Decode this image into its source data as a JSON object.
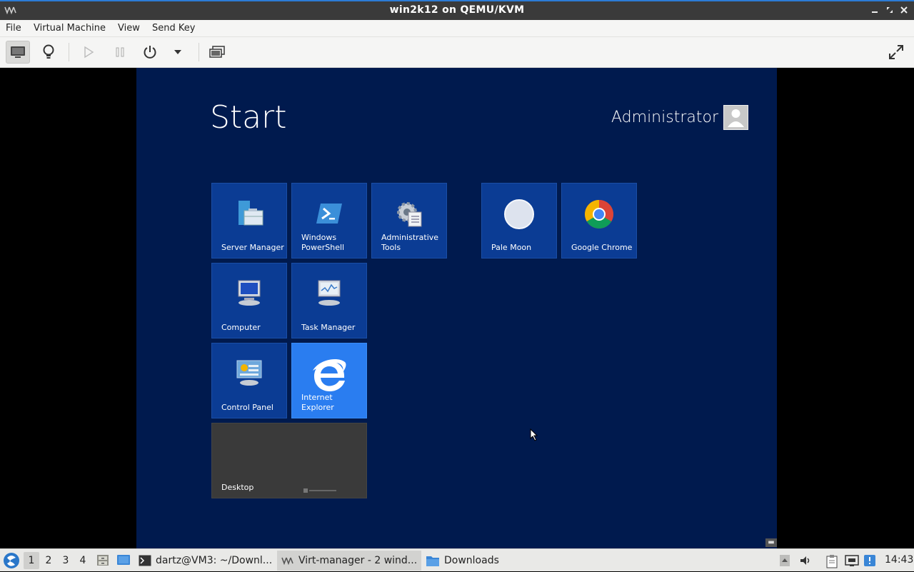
{
  "window": {
    "title": "win2k12 on QEMU/KVM"
  },
  "menu": {
    "file": "File",
    "virtual_machine": "Virtual Machine",
    "view": "View",
    "send_key": "Send Key"
  },
  "guest": {
    "start_title": "Start",
    "user_name": "Administrator",
    "tiles": {
      "server_manager": "Server Manager",
      "powershell": "Windows\nPowerShell",
      "admin_tools": "Administrative\nTools",
      "pale_moon": "Pale Moon",
      "chrome": "Google Chrome",
      "computer": "Computer",
      "task_manager": "Task Manager",
      "control_panel": "Control Panel",
      "internet_explorer": "Internet Explorer",
      "desktop": "Desktop"
    }
  },
  "taskbar": {
    "workspaces": [
      "1",
      "2",
      "3",
      "4"
    ],
    "tasks": {
      "terminal": "dartz@VM3: ~/Downl...",
      "virt_manager": "Virt-manager - 2 wind...",
      "downloads": "Downloads"
    },
    "clock": "14:43"
  },
  "colors": {
    "guest_bg": "#001a4e",
    "tile_bg": "#0b3c94",
    "ie_tile": "#2a7df0",
    "accent": "#2c7bd6"
  }
}
